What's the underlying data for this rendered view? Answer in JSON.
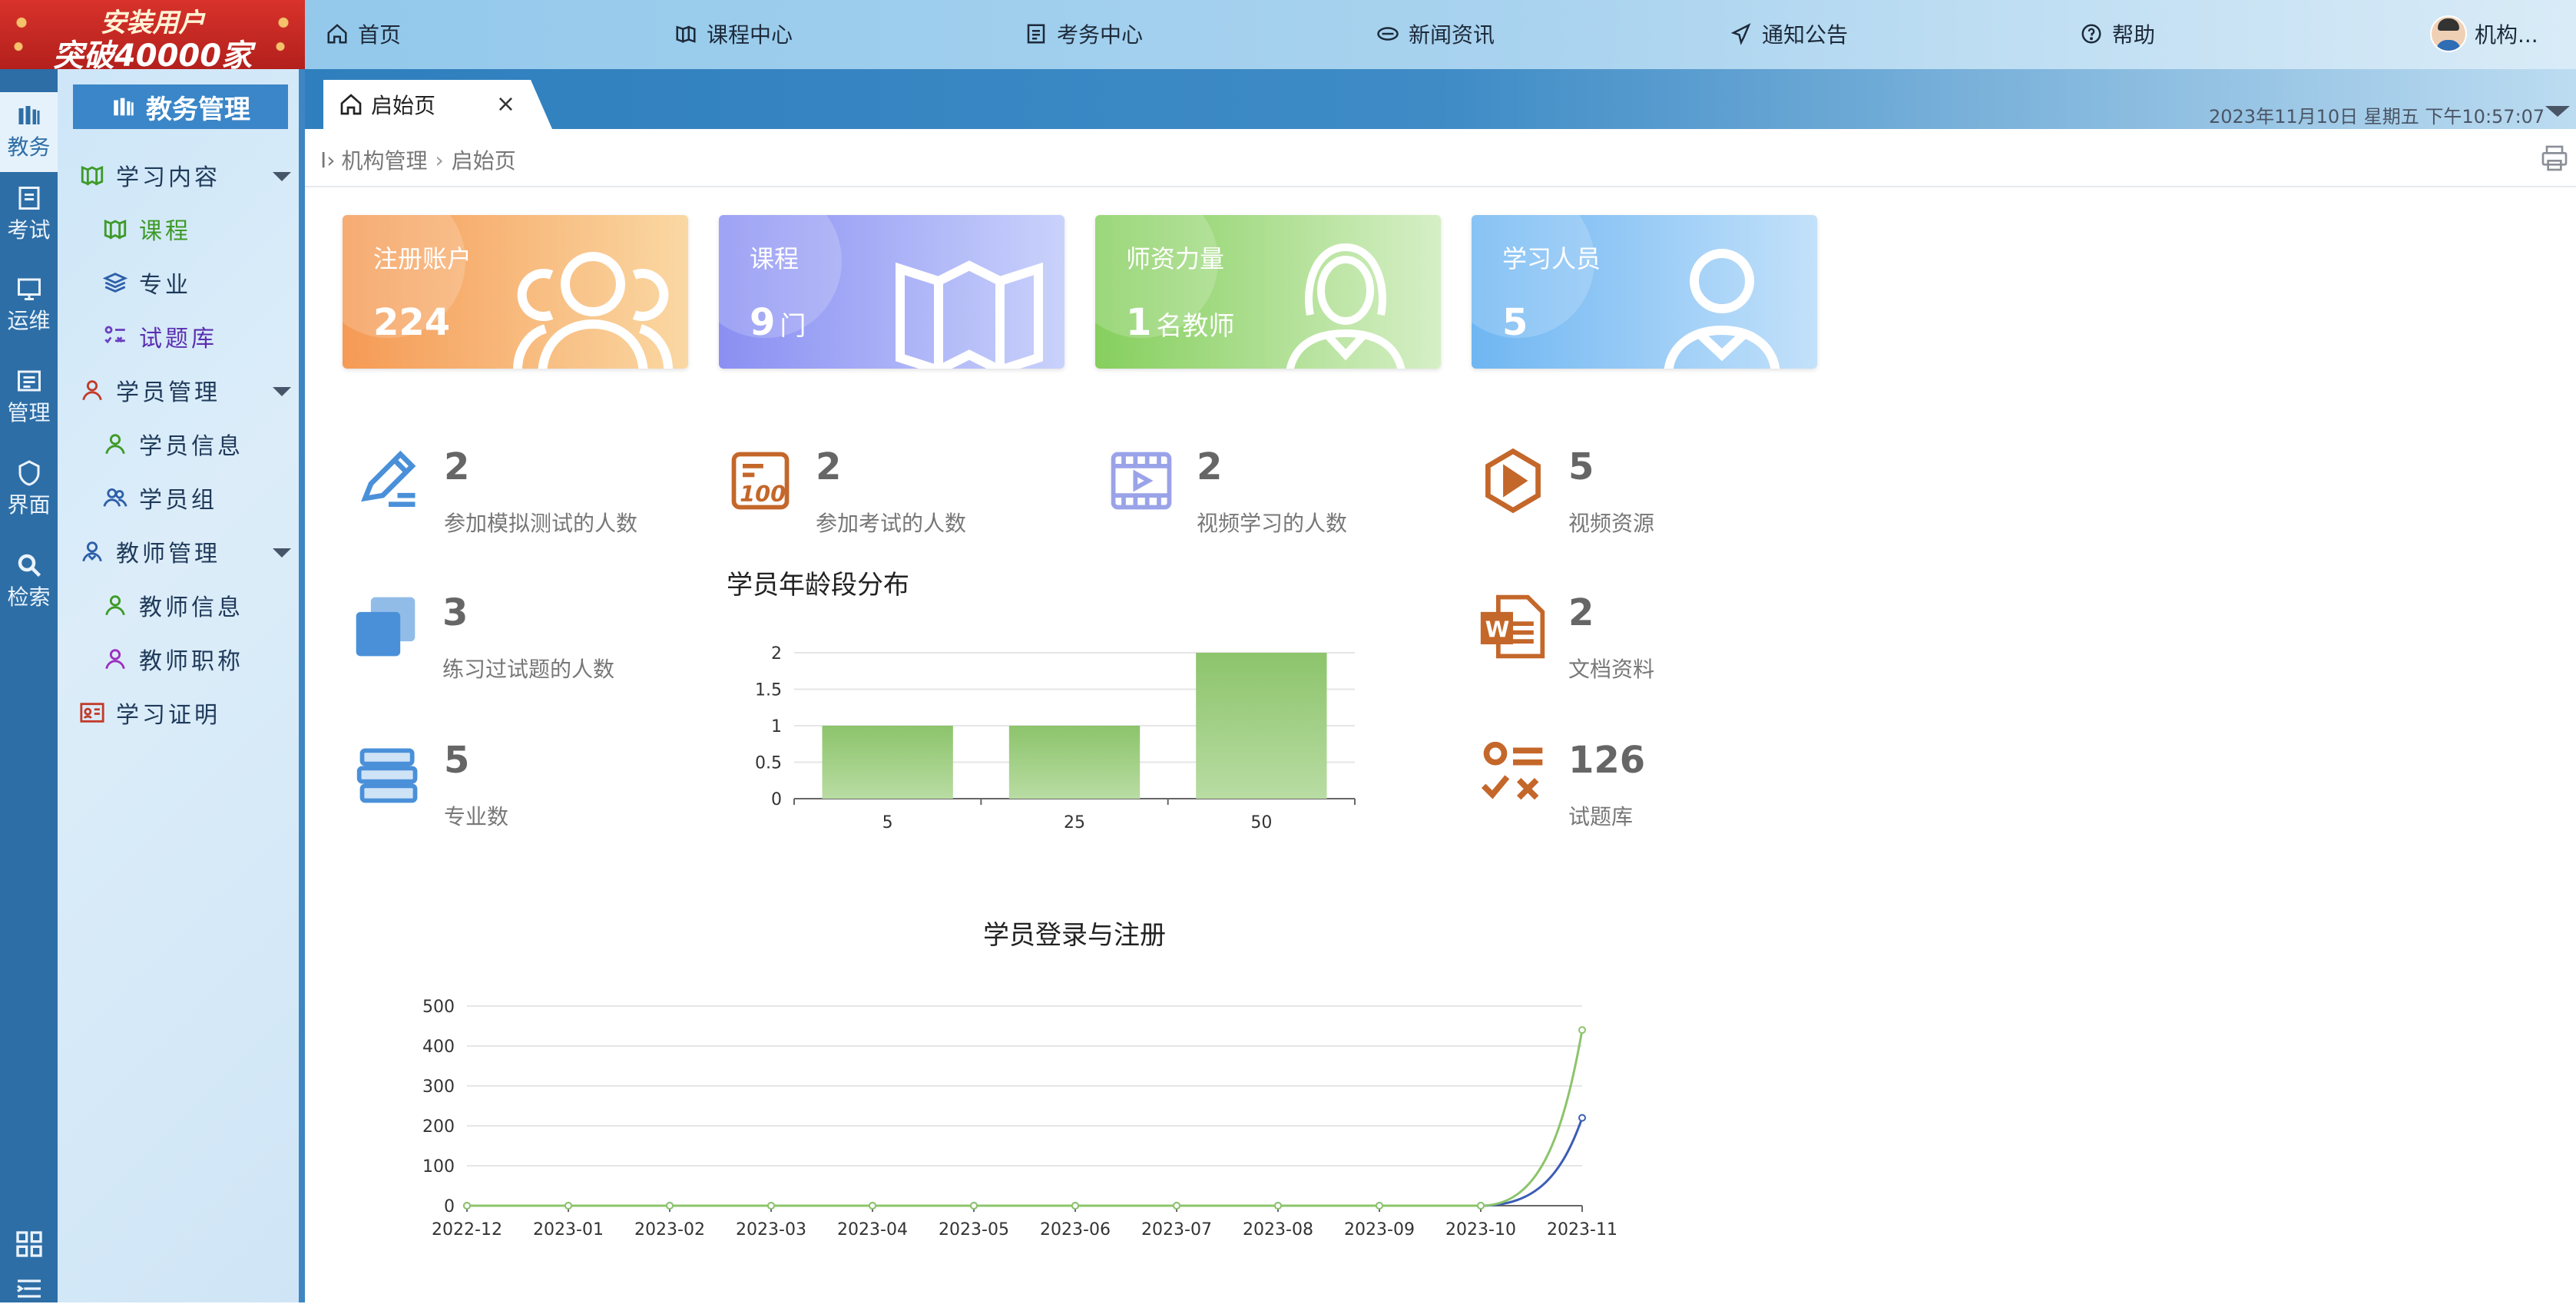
{
  "promo": {
    "line1": "安装用户",
    "line2": "突破40000家"
  },
  "topnav": [
    {
      "label": "首页",
      "icon": "home-icon"
    },
    {
      "label": "课程中心",
      "icon": "book-icon"
    },
    {
      "label": "考务中心",
      "icon": "exam-icon"
    },
    {
      "label": "新闻资讯",
      "icon": "news-icon"
    },
    {
      "label": "通知公告",
      "icon": "notice-icon"
    },
    {
      "label": "帮助",
      "icon": "help-icon"
    }
  ],
  "user": {
    "name": "机构..."
  },
  "rail": [
    {
      "label": "教务"
    },
    {
      "label": "考试"
    },
    {
      "label": "运维"
    },
    {
      "label": "管理"
    },
    {
      "label": "界面"
    },
    {
      "label": "检索"
    }
  ],
  "menu": {
    "title": "教务管理",
    "groups": [
      {
        "label": "学习内容",
        "items": [
          "课程",
          "专业",
          "试题库"
        ]
      },
      {
        "label": "学员管理",
        "items": [
          "学员信息",
          "学员组"
        ]
      },
      {
        "label": "教师管理",
        "items": [
          "教师信息",
          "教师职称"
        ]
      },
      {
        "label": "学习证明",
        "items": []
      }
    ]
  },
  "tab": {
    "label": "启始页",
    "close": "×"
  },
  "clock": "2023年11月10日 星期五 下午10:57:07",
  "breadcrumb": {
    "prefix": "I›",
    "items": [
      "机构管理",
      "启始页"
    ],
    "sep": "›"
  },
  "cards": [
    {
      "title": "注册账户",
      "value": "224",
      "unit": ""
    },
    {
      "title": "课程",
      "value": "9",
      "unit": "门"
    },
    {
      "title": "师资力量",
      "value": "1",
      "unit": "名教师"
    },
    {
      "title": "学习人员",
      "value": "5",
      "unit": ""
    }
  ],
  "stats": [
    {
      "value": "2",
      "label": "参加模拟测试的人数",
      "icon": "pen-icon"
    },
    {
      "value": "2",
      "label": "参加考试的人数",
      "icon": "score-100-icon"
    },
    {
      "value": "2",
      "label": "视频学习的人数",
      "icon": "video-film-icon"
    },
    {
      "value": "5",
      "label": "视频资源",
      "icon": "play-icon"
    },
    {
      "value": "3",
      "label": "练习过试题的人数",
      "icon": "copy-icon"
    },
    {
      "value": "2",
      "label": "文档资料",
      "icon": "word-doc-icon"
    },
    {
      "value": "5",
      "label": "专业数",
      "icon": "books-stack-icon"
    },
    {
      "value": "126",
      "label": "试题库",
      "icon": "quiz-icon"
    }
  ],
  "colors": {
    "card1": "#f5a05a",
    "card2": "#8f9cf3",
    "card3": "#8fd36a",
    "card4": "#7cbcf4",
    "bar": "#8cc46b",
    "line_login": "#8cc46b",
    "line_register": "#3b5db5",
    "statIconBlue": "#4a90d9",
    "statIconOrange": "#c4672a"
  },
  "chart_data": [
    {
      "type": "bar",
      "title": "学员年龄段分布",
      "categories": [
        "5",
        "25",
        "50"
      ],
      "values": [
        1,
        1,
        2
      ],
      "ylim": [
        0,
        2
      ],
      "yticks": [
        "0",
        "0.5",
        "1",
        "1.5",
        "2"
      ]
    },
    {
      "type": "line",
      "title": "学员登录与注册",
      "x": [
        "2022-12",
        "2023-01",
        "2023-02",
        "2023-03",
        "2023-04",
        "2023-05",
        "2023-06",
        "2023-07",
        "2023-08",
        "2023-09",
        "2023-10",
        "2023-11"
      ],
      "series": [
        {
          "values": [
            0,
            0,
            0,
            0,
            0,
            0,
            0,
            0,
            0,
            0,
            0,
            440
          ]
        },
        {
          "values": [
            0,
            0,
            0,
            0,
            0,
            0,
            0,
            0,
            0,
            0,
            0,
            220
          ]
        }
      ],
      "ylim": [
        0,
        500
      ],
      "yticks": [
        "0",
        "100",
        "200",
        "300",
        "400",
        "500"
      ]
    }
  ]
}
